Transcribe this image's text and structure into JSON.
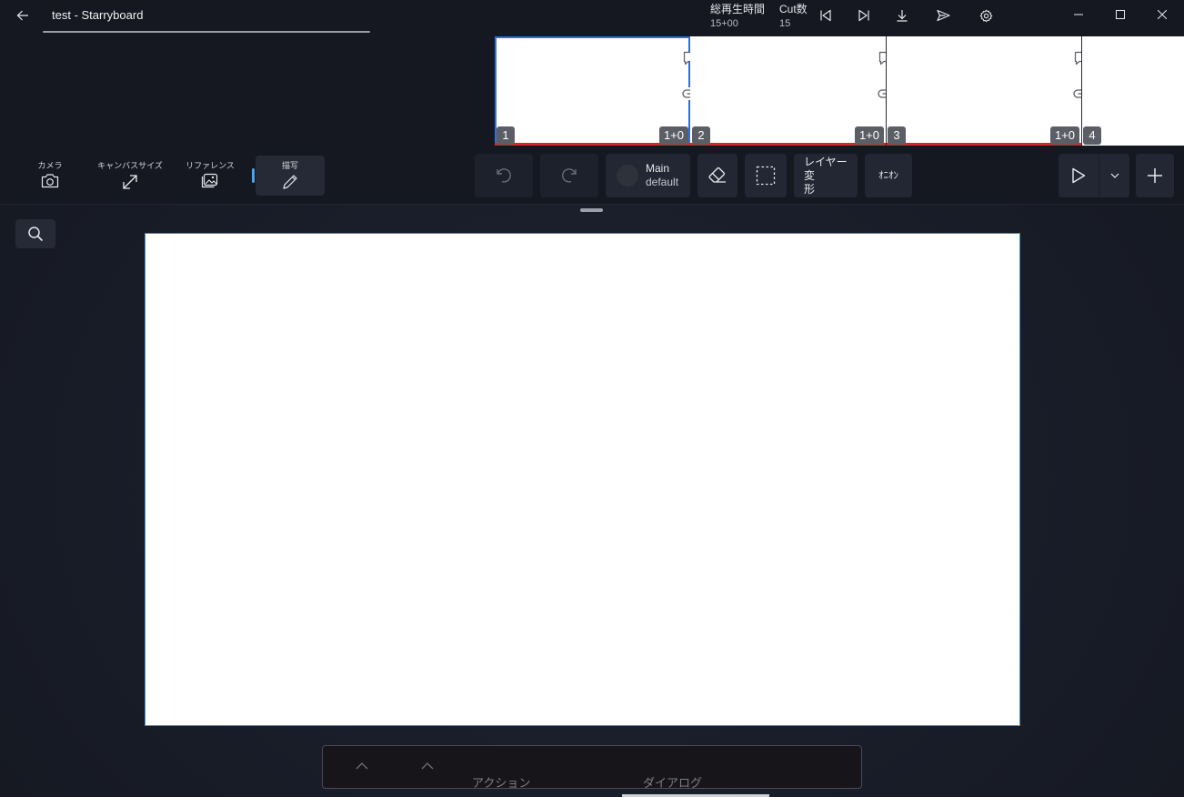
{
  "window": {
    "title": "test - Starryboard"
  },
  "stats": {
    "total_time_label": "総再生時間",
    "total_time_value": "15+00",
    "cut_count_label": "Cut数",
    "cut_count_value": "15"
  },
  "thumbnails": [
    {
      "number": "1",
      "duration": "1+0",
      "selected": true
    },
    {
      "number": "2",
      "duration": "1+0",
      "selected": false
    },
    {
      "number": "3",
      "duration": "1+0",
      "selected": false
    },
    {
      "number": "4",
      "duration": "",
      "selected": false
    }
  ],
  "tools": {
    "camera_label": "カメラ",
    "canvas_size_label": "キャンバスサイズ",
    "reference_label": "リファレンス",
    "draw_label": "描写"
  },
  "toolbar": {
    "layer_name": "Main",
    "layer_sub": "default",
    "layer_transform_label_1": "レイヤー変",
    "layer_transform_label_2": "形",
    "onion_label": "ｵﾆｵﾝ"
  },
  "bottom_panel": {
    "action_label": "アクション",
    "dialog_label": "ダイアログ"
  },
  "colors": {
    "accent_blue": "#2e6fd8",
    "cut_line_red": "#d0282b",
    "canvas_border": "#3a8fd6"
  }
}
